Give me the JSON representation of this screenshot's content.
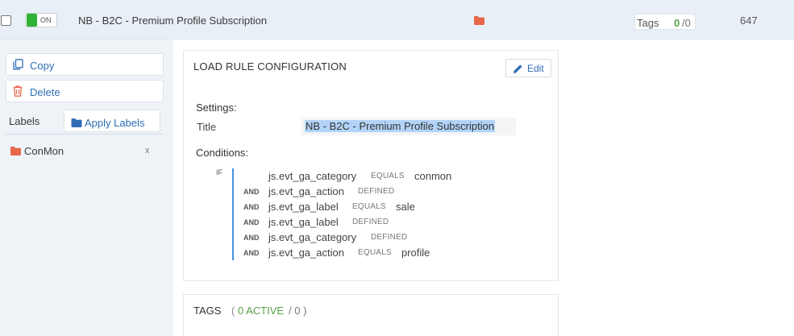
{
  "header": {
    "toggle_label": "ON",
    "title": "NB - B2C - Premium Profile Subscription",
    "tags_label": "Tags",
    "tags_active": "0",
    "tags_total": "/0",
    "id_number": "647"
  },
  "sidebar": {
    "copy_label": "Copy",
    "delete_label": "Delete",
    "labels_heading": "Labels",
    "apply_labels": "Apply Labels",
    "label_items": [
      {
        "name": "ConMon",
        "remove": "x"
      }
    ]
  },
  "load_rule": {
    "heading": "LOAD RULE CONFIGURATION",
    "edit_label": "Edit",
    "settings_heading": "Settings:",
    "title_label": "Title",
    "title_value": "NB - B2C - Premium Profile Subscription",
    "conditions_heading": "Conditions:",
    "if_label": "IF",
    "conditions": [
      {
        "op": "",
        "variable": "js.evt_ga_category",
        "operator": "EQUALS",
        "value": "conmon"
      },
      {
        "op": "AND",
        "variable": "js.evt_ga_action",
        "operator": "DEFINED",
        "value": ""
      },
      {
        "op": "AND",
        "variable": "js.evt_ga_label",
        "operator": "EQUALS",
        "value": "sale"
      },
      {
        "op": "AND",
        "variable": "js.evt_ga_label",
        "operator": "DEFINED",
        "value": ""
      },
      {
        "op": "AND",
        "variable": "js.evt_ga_category",
        "operator": "DEFINED",
        "value": ""
      },
      {
        "op": "AND",
        "variable": "js.evt_ga_action",
        "operator": "EQUALS",
        "value": "profile"
      }
    ]
  },
  "tags_panel": {
    "heading": "TAGS",
    "open_paren": "(",
    "active": "0 ACTIVE",
    "total": "/ 0 )"
  },
  "colors": {
    "accent_blue": "#2f6db5",
    "toggle_green": "#2fb135",
    "folder_orange": "#e8674a",
    "active_green": "#5aa14a",
    "condition_bar": "#4a90e2"
  },
  "icons": [
    "checkbox",
    "toggle-switch",
    "folder-icon",
    "copy-icon",
    "trash-icon",
    "pencil-icon"
  ]
}
